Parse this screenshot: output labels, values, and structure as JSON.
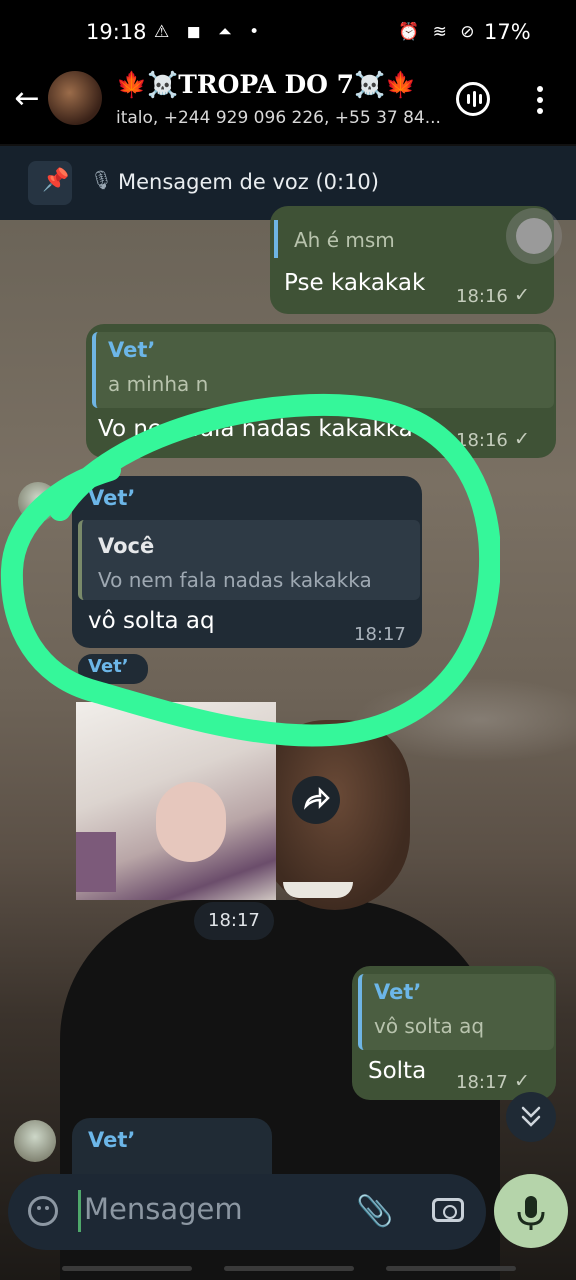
{
  "status_bar": {
    "time": "19:18",
    "left_icons": "⚠ ◼ ⏶ •",
    "right_icons": "⏰ ≋ ⊘",
    "battery": "17%"
  },
  "header": {
    "back_icon": "←",
    "title": "🍁☠️TROPA DO 7☠️🍁",
    "subtitle": "italo, +244 929 096 226, +55 37 84..."
  },
  "pinned": {
    "text": "Mensagem de voz (0:10)"
  },
  "messages": [
    {
      "type": "out",
      "quote_text": "Ah é msm",
      "text": "Pse kakakak",
      "time": "18:16"
    },
    {
      "type": "out",
      "quote_name": "Vet’",
      "quote_text": "a minha n",
      "text": "Vo nem fala nadas kakakka",
      "time": "18:16"
    },
    {
      "type": "in",
      "sender": "Vet’",
      "quote_name": "Você",
      "quote_text": "Vo nem fala nadas kakakka",
      "text": "vô solta aq",
      "time": "18:17"
    },
    {
      "type": "in-photo",
      "sender": "Vet’",
      "time": "18:17"
    },
    {
      "type": "out",
      "quote_name": "Vet’",
      "quote_text": "vô solta aq",
      "text": "Solta",
      "time": "18:17"
    },
    {
      "type": "in",
      "sender": "Vet’"
    }
  ],
  "composer": {
    "placeholder": "Mensagem"
  },
  "colors": {
    "annotation": "#35f79a",
    "outgoing": "#3f5236",
    "incoming": "#202b35",
    "name": "#6cb6e8"
  }
}
